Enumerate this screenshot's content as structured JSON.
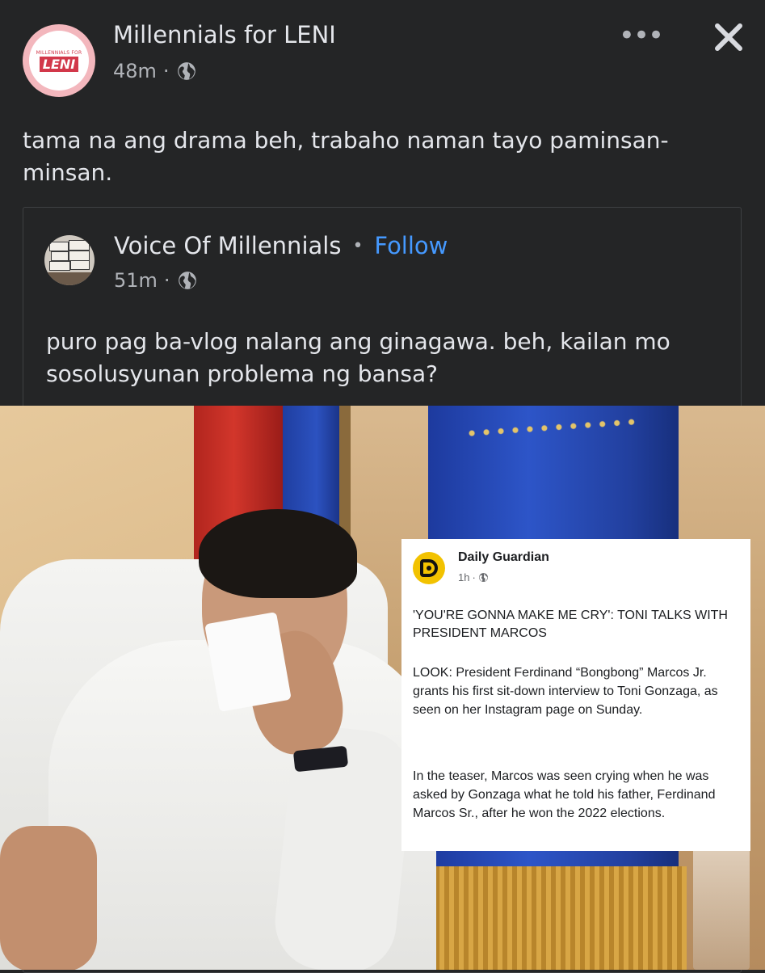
{
  "post": {
    "author": "Millennials for LENI",
    "avatar_brand": "LENI",
    "avatar_small_text": "MILLENNIALS FOR",
    "time": "48m",
    "separator": "·",
    "privacy_icon": "globe-icon",
    "more_label": "•••",
    "close_icon": "close-icon",
    "text": "tama na ang drama beh, trabaho naman tayo paminsan-minsan."
  },
  "shared": {
    "author": "Voice Of Millennials",
    "bullet": "•",
    "follow_label": "Follow",
    "time": "51m",
    "separator": "·",
    "privacy_icon": "globe-icon",
    "text": "puro pag ba-vlog nalang ang ginagawa. beh, kailan mo sosolusyunan problema ng bansa?"
  },
  "news_card": {
    "source": "Daily Guardian",
    "time": "1h",
    "separator": "·",
    "headline": "'YOU'RE GONNA MAKE ME CRY': TONI TALKS WITH PRESIDENT MARCOS",
    "paragraph1": "LOOK: President Ferdinand “Bongbong” Marcos Jr. grants his first sit-down interview to Toni Gonzaga, as seen on her Instagram page on Sunday.",
    "paragraph2": "In the teaser, Marcos was seen crying when he was asked by Gonzaga what he told his father, Ferdinand Marcos Sr., after he won the 2022 elections."
  },
  "colors": {
    "background": "#242526",
    "primary_text": "#e4e6eb",
    "secondary_text": "#b0b3b8",
    "follow_link": "#4599ff",
    "brand_red": "#d2384a",
    "daily_guardian_yellow": "#f2c200"
  }
}
